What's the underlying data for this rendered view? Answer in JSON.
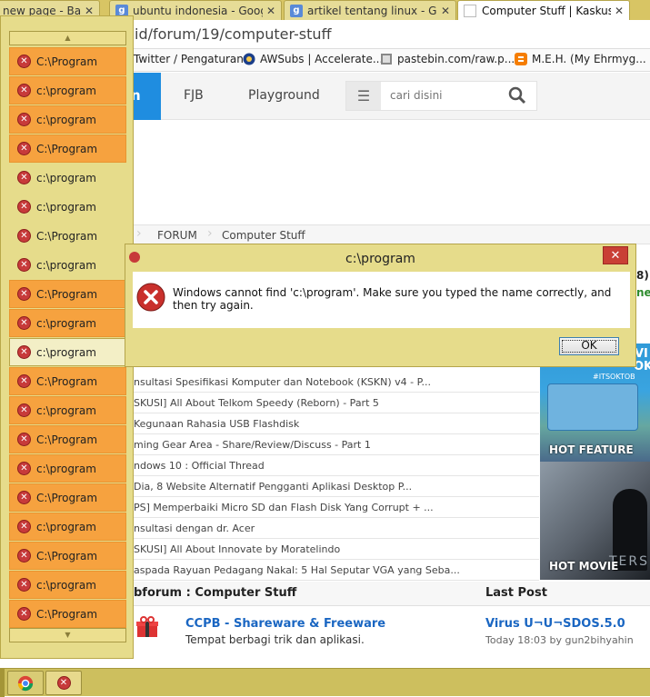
{
  "tabs": [
    {
      "title": "new page - Bayu",
      "icon": "none"
    },
    {
      "title": "ubuntu indonesia - Googl",
      "icon": "google"
    },
    {
      "title": "artikel tentang linux - Goo",
      "icon": "google"
    },
    {
      "title": "Computer Stuff | Kaskus -",
      "icon": "kaskus",
      "active": true
    }
  ],
  "address": "id/forum/19/computer-stuff",
  "bookmarks": [
    "Twitter / Pengaturan",
    "AWSubs | Accelerate...",
    "pastebin.com/raw.p...",
    "M.E.H. (My Ehrmyg..."
  ],
  "site_nav": {
    "brand_fragment": "n",
    "links": [
      "FJB",
      "Playground"
    ],
    "search_placeholder": "cari disini"
  },
  "breadcrumb": [
    "FORUM",
    "Computer Stuff"
  ],
  "partial_right_text": {
    "top": "8)",
    "bottom": "ne"
  },
  "threads": [
    "nsultasi Spesifikasi Komputer dan Notebook (KSKN) v4 - P...",
    "SKUSI] All About Telkom Speedy (Reborn) - Part 5",
    "Kegunaan Rahasia USB Flashdisk",
    "ming Gear Area - Share/Review/Discuss - Part 1",
    "ndows 10 : Official Thread",
    "Dia, 8 Website Alternatif Pengganti Aplikasi Desktop P...",
    "PS] Memperbaiki Micro SD dan Flash Disk Yang Corrupt + ...",
    "nsultasi dengan dr. Acer",
    "SKUSI] All About Innovate by Moratelindo",
    "aspada Rayuan Pedagang Nakal: 5 Hal Seputar VGA yang Seba..."
  ],
  "ads": {
    "feature_label": "HOT FEATURE",
    "movie_label": "HOT MOVIE",
    "feature_top_text": "VI",
    "feature_top_text2": "OK",
    "feature_tag": "#ITSOKTOB",
    "movie_overlay": "TERS"
  },
  "subforum": {
    "header": "bforum : Computer Stuff",
    "last_post_header": "Last Post",
    "item_title": "CCPB - Shareware & Freeware",
    "item_desc": "Tempat berbagi trik dan aplikasi.",
    "last_post_title": "Virus U¬U¬SDOS.5.0",
    "last_post_meta": "Today 18:03 by gun2bihyahin"
  },
  "jump_list": {
    "items": [
      {
        "label": "C:\\Program",
        "state": "hl"
      },
      {
        "label": "c:\\program",
        "state": "hl"
      },
      {
        "label": "c:\\program",
        "state": "hl"
      },
      {
        "label": "C:\\Program",
        "state": "hl"
      },
      {
        "label": "c:\\program",
        "state": "plain"
      },
      {
        "label": "c:\\program",
        "state": "plain"
      },
      {
        "label": "C:\\Program",
        "state": "plain"
      },
      {
        "label": "c:\\program",
        "state": "plain"
      },
      {
        "label": "C:\\Program",
        "state": "hl"
      },
      {
        "label": "c:\\program",
        "state": "hl"
      },
      {
        "label": "c:\\program",
        "state": "sel"
      },
      {
        "label": "C:\\Program",
        "state": "hl"
      },
      {
        "label": "c:\\program",
        "state": "hl"
      },
      {
        "label": "C:\\Program",
        "state": "hl"
      },
      {
        "label": "c:\\program",
        "state": "hl"
      },
      {
        "label": "C:\\Program",
        "state": "hl"
      },
      {
        "label": "c:\\program",
        "state": "hl"
      },
      {
        "label": "C:\\Program",
        "state": "hl"
      },
      {
        "label": "c:\\program",
        "state": "hl"
      },
      {
        "label": "C:\\Program",
        "state": "hl"
      }
    ]
  },
  "dialog": {
    "title": "c:\\program",
    "message": "Windows cannot find 'c:\\program'. Make sure you typed the name correctly, and then try again.",
    "ok_label": "OK",
    "close_glyph": "✕"
  },
  "colors": {
    "accent_blue": "#1f8de0",
    "jumplist_highlight": "#f6a23f",
    "window_frame": "#e6dc8b",
    "link_blue": "#1a66c2"
  }
}
